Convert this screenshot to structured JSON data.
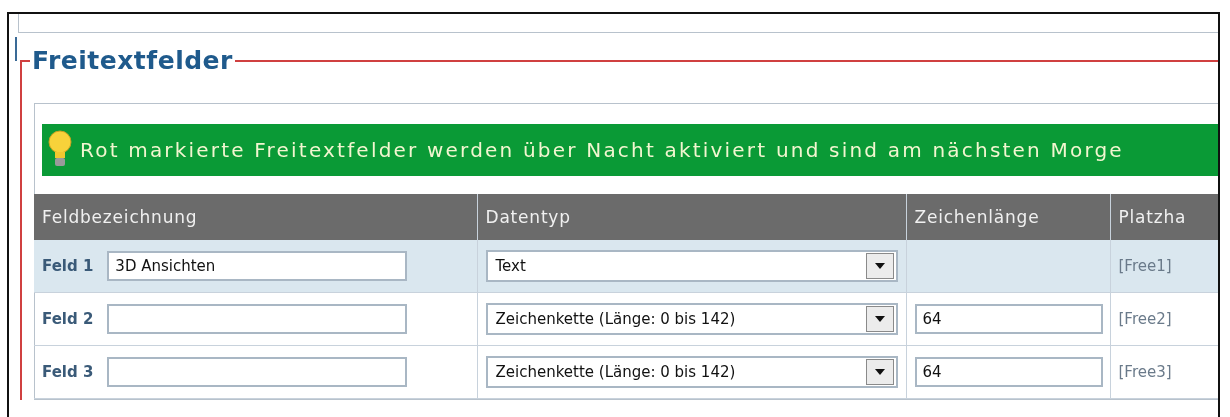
{
  "section": {
    "legend": "Freitextfelder"
  },
  "notice": {
    "text": "Rot markierte Freitextfelder werden über Nacht aktiviert und sind am nächsten Morge"
  },
  "table": {
    "columns": [
      "Feldbezeichnung",
      "Datentyp",
      "Zeichenlänge",
      "Platzha"
    ],
    "rows": [
      {
        "label": "Feld 1",
        "name": "3D Ansichten",
        "type": "Text",
        "length": "",
        "placeholder_code": "[Free1]",
        "highlighted": true
      },
      {
        "label": "Feld 2",
        "name": "",
        "type": "Zeichenkette (Länge: 0 bis 142)",
        "length": "64",
        "placeholder_code": "[Free2]",
        "highlighted": false
      },
      {
        "label": "Feld 3",
        "name": "",
        "type": "Zeichenkette (Länge: 0 bis 142)",
        "length": "64",
        "placeholder_code": "[Free3]",
        "highlighted": false
      }
    ]
  }
}
